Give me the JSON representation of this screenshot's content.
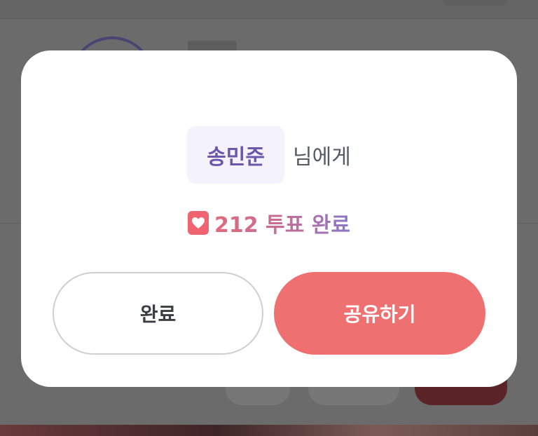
{
  "modal": {
    "recipient_name": "송민준",
    "recipient_suffix": "님에게",
    "vote_count": "212",
    "vote_suffix": "투표 완료",
    "buttons": {
      "done_label": "완료",
      "share_label": "공유하기"
    },
    "icons": {
      "vote": "heart-icon"
    }
  },
  "colors": {
    "accent_purple": "#6a58ad",
    "share_button": "#ef7071",
    "heart": "#ef6470"
  }
}
